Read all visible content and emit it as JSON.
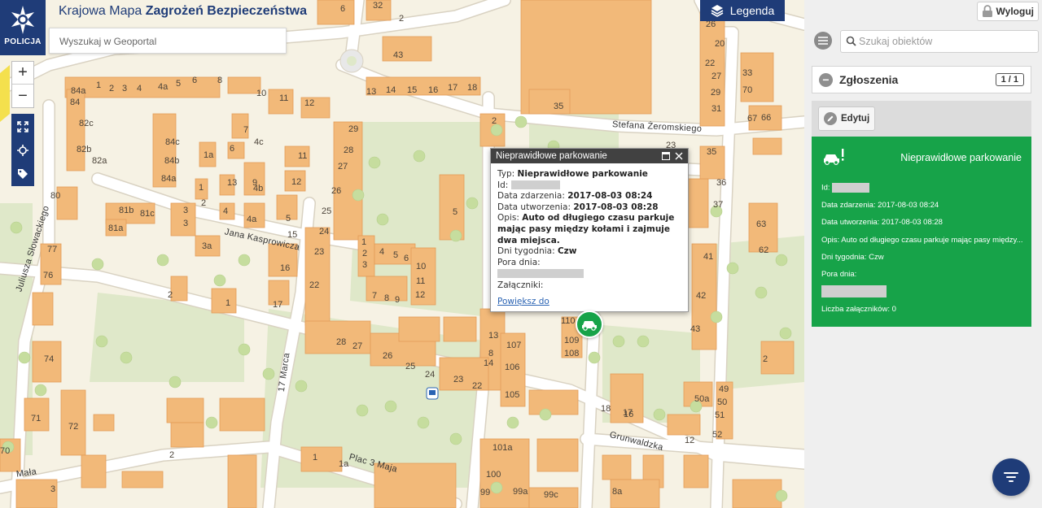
{
  "header": {
    "logo_text": "POLICJA",
    "title_light": "Krajowa Mapa ",
    "title_bold": "Zagrożeń Bezpieczeństwa",
    "search_placeholder": "Wyszukaj w Geoportal",
    "legend_label": "Legenda"
  },
  "map": {
    "zoom_in": "+",
    "zoom_out": "−",
    "streets": [
      "Stefana Żeromskiego",
      "Jana Kasprowicza",
      "Juliusza Słowackiego",
      "17 Marca",
      "Grunwaldzka",
      "Plac 3 Maja",
      "Mała"
    ],
    "house_numbers": [
      "6",
      "32",
      "2",
      "28",
      "26",
      "43",
      "13",
      "14",
      "15",
      "16",
      "17",
      "18",
      "35",
      "20",
      "22",
      "27",
      "29",
      "31",
      "33",
      "70",
      "1",
      "2",
      "3",
      "4",
      "4a",
      "5",
      "6",
      "8",
      "10",
      "11",
      "12",
      "84a",
      "84",
      "82c",
      "82b",
      "82a",
      "84c",
      "84b",
      "84a",
      "1a",
      "7",
      "6",
      "4c",
      "11",
      "9",
      "12",
      "13",
      "1",
      "2",
      "4",
      "4b",
      "4a",
      "5",
      "3",
      "81b",
      "81c",
      "81a",
      "3",
      "15",
      "3a",
      "16",
      "2",
      "1",
      "17",
      "80",
      "77",
      "76",
      "74",
      "29",
      "28",
      "27",
      "26",
      "25",
      "24",
      "23",
      "22",
      "1",
      "2",
      "3",
      "4",
      "5",
      "6",
      "10",
      "11",
      "12",
      "7",
      "8",
      "9",
      "28",
      "27",
      "26",
      "25",
      "24",
      "23",
      "22",
      "2",
      "14",
      "13",
      "8",
      "106",
      "105",
      "107",
      "110",
      "109",
      "108",
      "5",
      "18",
      "17",
      "16",
      "35",
      "36",
      "37",
      "23",
      "41",
      "42",
      "43",
      "67",
      "66",
      "63",
      "62",
      "2",
      "50a",
      "49",
      "50",
      "51",
      "52",
      "12",
      "71",
      "72",
      "70",
      "1",
      "1a",
      "101a",
      "100",
      "99",
      "99a",
      "99c",
      "8a",
      "3",
      "2"
    ]
  },
  "popup": {
    "title": "Nieprawidłowe parkowanie",
    "typ_label": "Typ:",
    "typ_value": "Nieprawidłowe parkowanie",
    "id_label": "Id:",
    "date_event_label": "Data zdarzenia:",
    "date_event_value": "2017-08-03 08:24",
    "date_created_label": "Data utworzenia:",
    "date_created_value": "2017-08-03 08:28",
    "desc_label": "Opis:",
    "desc_value": "Auto od długiego czasu parkuje mając pasy między kołami i zajmuje dwa miejsca.",
    "days_label": "Dni tygodnia:",
    "days_value": "Czw",
    "time_label": "Pora dnia:",
    "attachments_label": "Załączniki:",
    "zoom_link": "Powiększ do"
  },
  "panel": {
    "logout_label": "Wyloguj",
    "search_placeholder": "Szukaj obiektów",
    "section_title": "Zgłoszenia",
    "pager": "1 / 1",
    "edit_label": "Edytuj",
    "card": {
      "title": "Nieprawidłowe parkowanie",
      "id_label": "Id:",
      "date_event": "Data zdarzenia: 2017-08-03 08:24",
      "date_created": "Data utworzenia: 2017-08-03 08:28",
      "description": "Opis: Auto od długiego czasu parkuje mając pasy między...",
      "days": "Dni tygodnia: Czw",
      "time_label": "Pora dnia:",
      "attachments": "Liczba załączników: 0"
    }
  },
  "colors": {
    "brand": "#1f3c78",
    "report_green": "#17a349",
    "building": "#f2b979"
  }
}
